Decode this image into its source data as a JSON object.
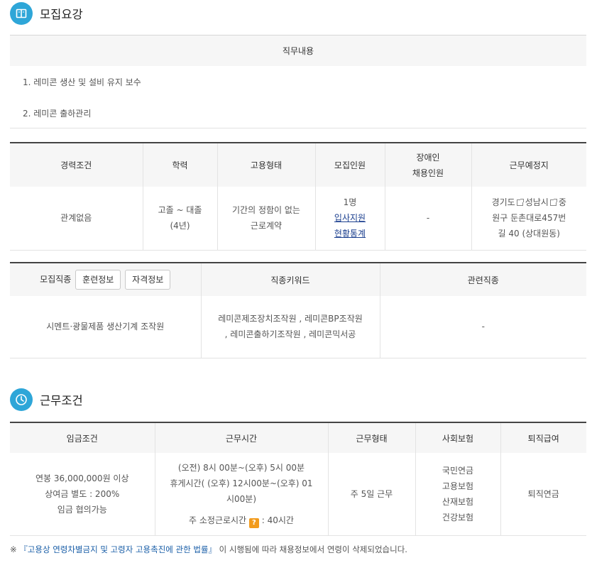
{
  "recruit": {
    "title": "모집요강",
    "duty": {
      "header": "직무내용",
      "items": [
        "1. 레미콘 생산 및 설비 유지 보수",
        "2. 레미콘 출하관리"
      ]
    },
    "conditions": {
      "headers": {
        "career": "경력조건",
        "education": "학력",
        "employment": "고용형태",
        "headcount": "모집인원",
        "disabled_line1": "장애인",
        "disabled_line2": "채용인원",
        "location": "근무예정지"
      },
      "career": "관계없음",
      "education_line1": "고졸 ~ 대졸",
      "education_line2": "(4년)",
      "employment_line1": "기간의 정함이 없는",
      "employment_line2": "근로계약",
      "headcount": "1명",
      "apply_link_line1": "입사지원",
      "apply_link_line2": "현황통계",
      "disabled": "-",
      "location_part1": "경기도",
      "location_part2": "성남시",
      "location_part3": "중",
      "location_line2": "원구 둔촌대로457번",
      "location_line3": "길 40 (상대원동)"
    },
    "job": {
      "headers": {
        "job_category": "모집직종",
        "keywords": "직종키워드",
        "related": "관련직종"
      },
      "training_button": "훈련정보",
      "license_button": "자격정보",
      "job_category": "시멘트·광물제품 생산기계 조작원",
      "keywords_line1": "레미콘제조장치조작원 , 레미콘BP조작원",
      "keywords_line2": ", 레미콘출하기조작원 , 레미콘믹서공",
      "related": "-"
    }
  },
  "work": {
    "title": "근무조건",
    "headers": {
      "wage": "임금조건",
      "hours": "근무시간",
      "type": "근무형태",
      "insurance": "사회보험",
      "retirement": "퇴직급여"
    },
    "wage_line1": "연봉 36,000,000원 이상",
    "wage_line2": "상여금 별도 : 200%",
    "wage_line3": "임금 협의가능",
    "hours_line1": "(오전) 8시 00분~(오후) 5시 00분",
    "hours_line2": "휴게시간( (오후) 12시00분~(오후) 01",
    "hours_line3": "시00분)",
    "weekly_hours_label": "주 소정근로시간",
    "help_badge": "?",
    "weekly_hours_value": ": 40시간",
    "type": "주 5일 근무",
    "insurance": [
      "국민연금",
      "고용보험",
      "산재보험",
      "건강보험"
    ],
    "retirement": "퇴직연금"
  },
  "footnote": {
    "prefix": "※ ",
    "law": "『고용상 연령차별금지 및 고령자 고용촉진에 관한 법률』",
    "suffix": "이 시행됨에 따라 채용정보에서 연령이 삭제되었습니다."
  },
  "colors": {
    "accent": "#2ea6d8",
    "link": "#1b3f8f",
    "badge": "#f29b1c"
  }
}
